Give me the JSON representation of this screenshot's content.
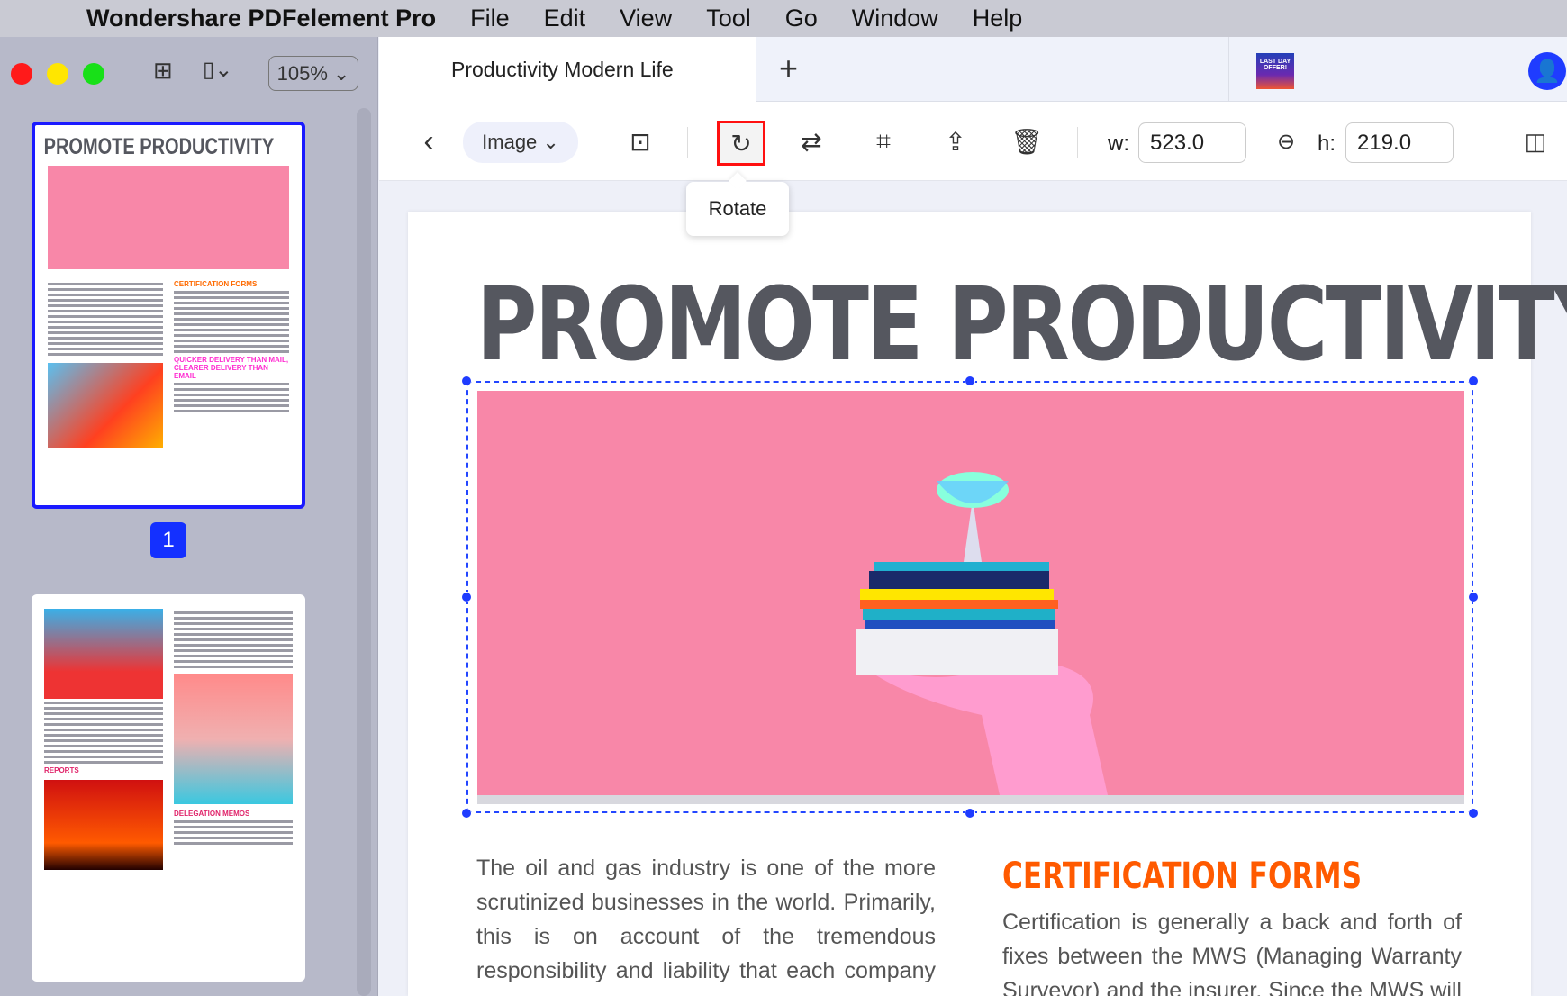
{
  "menubar": {
    "app": "Wondershare PDFelement Pro",
    "items": [
      "File",
      "Edit",
      "View",
      "Tool",
      "Go",
      "Window",
      "Help"
    ]
  },
  "sidebar": {
    "zoom": "105%",
    "current_page": "1",
    "thumb1": {
      "title": "PROMOTE PRODUCTIVITY",
      "heading1": "CERTIFICATION FORMS",
      "heading2": "QUICKER DELIVERY THAN MAIL, CLEARER DELIVERY THAN EMAIL"
    },
    "thumb2": {
      "heading1": "REPORTS",
      "heading2": "DELEGATION MEMOS"
    }
  },
  "tabs": {
    "active": "Productivity Modern Life",
    "offer": "LAST DAY OFFER!"
  },
  "toolbar": {
    "mode": "Image",
    "w_label": "w:",
    "w_value": "523.0",
    "h_label": "h:",
    "h_value": "219.0",
    "tooltip": "Rotate"
  },
  "document": {
    "title": "PROMOTE PRODUCTIVITY",
    "left_text": "The oil and gas industry is one of the more scrutinized businesses in the world. Primarily, this is on account of the tremendous responsibility and liability that each company possesses. On the one hand, the business has",
    "right_heading": "CERTIFICATION FORMS",
    "right_text": "Certification is generally a back and forth of fixes between the MWS (Managing Warranty Surveyor) and the insurer. Since the MWS will determine if you have a COA"
  }
}
